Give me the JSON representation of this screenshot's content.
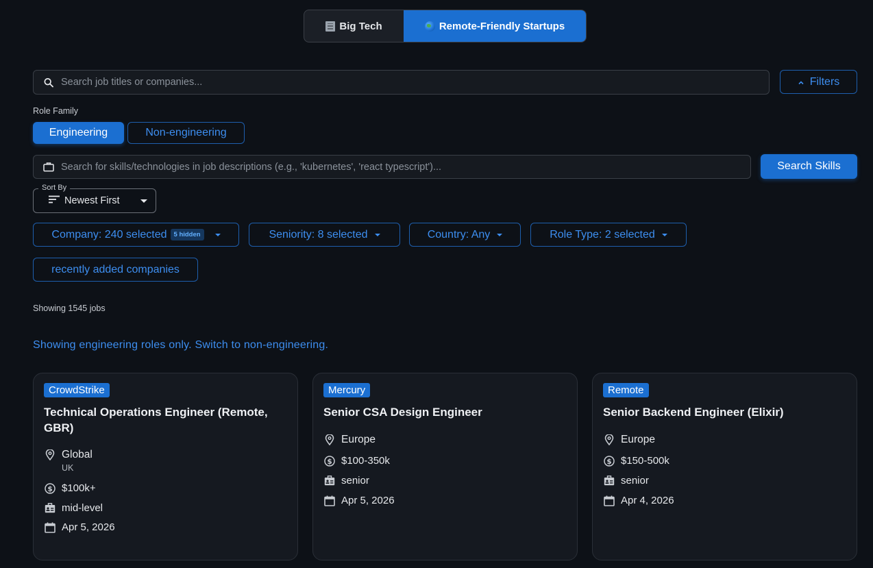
{
  "tabs": [
    {
      "label": "Big Tech",
      "icon": "building-icon",
      "selected": false
    },
    {
      "label": "Remote-Friendly Startups",
      "icon": "globe-icon",
      "selected": true
    }
  ],
  "search": {
    "placeholder": "Search job titles or companies..."
  },
  "filters_button": {
    "label": "Filters"
  },
  "role_family": {
    "label": "Role Family",
    "options": [
      "Engineering",
      "Non-engineering"
    ],
    "selected": "Engineering"
  },
  "skills": {
    "placeholder": "Search for skills/technologies in job descriptions (e.g., 'kubernetes', 'react typescript')...",
    "button_label": "Search Skills"
  },
  "sort": {
    "legend": "Sort By",
    "value": "Newest First"
  },
  "filter_chips": {
    "company": "Company: 240 selected",
    "company_badge": "5 hidden",
    "seniority": "Seniority: 8 selected",
    "country": "Country: Any",
    "role_type": "Role Type: 2 selected",
    "recent": "recently added companies"
  },
  "results_count": "Showing 1545 jobs",
  "notice": "Showing engineering roles only. Switch to non-engineering.",
  "jobs": [
    {
      "company": "CrowdStrike",
      "title": "Technical Operations Engineer (Remote, GBR)",
      "location": "Global",
      "location_sub": "UK",
      "salary": "$100k+",
      "level": "mid-level",
      "date": "Apr 5, 2026"
    },
    {
      "company": "Mercury",
      "title": "Senior CSA Design Engineer",
      "location": "Europe",
      "location_sub": "",
      "salary": "$100-350k",
      "level": "senior",
      "date": "Apr 5, 2026"
    },
    {
      "company": "Remote",
      "title": "Senior Backend Engineer (Elixir)",
      "location": "Europe",
      "location_sub": "",
      "salary": "$150-500k",
      "level": "senior",
      "date": "Apr 4, 2026"
    }
  ],
  "colors": {
    "accent": "#1b6fd1",
    "background": "#0d1117",
    "card": "#151920"
  }
}
